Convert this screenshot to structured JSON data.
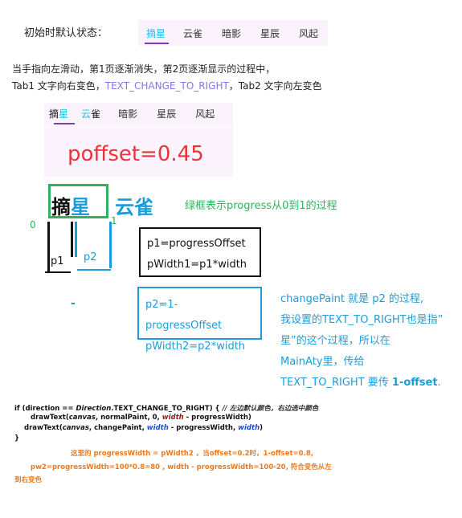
{
  "initial_state_label": "初始时默认状态：",
  "tabs": [
    "摘星",
    "云雀",
    "暗影",
    "星辰",
    "风起"
  ],
  "description": {
    "line1": "当手指向左滑动，第1页逐渐消失，第2页逐渐显示的过程中，",
    "line2_a": "Tab1 文字向右变色，",
    "line2_mode": "TEXT_CHANGE_TO_RIGHT",
    "line2_b": "，Tab2 文字向左变色"
  },
  "demo": {
    "tab1_part1": "摘",
    "tab1_part2": "星",
    "tab2_part1": "云",
    "tab2_part2": "雀",
    "poffset": "poffset=0.45"
  },
  "zoom": {
    "tab1_dark": "摘",
    "tab1_cyan": "星",
    "tab2": "云雀",
    "note": "绿框表示progress从0到1的过程",
    "label0": "0",
    "label1": "1",
    "p1": "p1",
    "p2": "p2",
    "dot": "-"
  },
  "box1": {
    "line1": "p1=progressOffset",
    "line2": "pWidth1=p1*width"
  },
  "box2": {
    "line1": "p2=1-progressOffset",
    "line2": "pWidth2=p2*width"
  },
  "blue_note": {
    "l1": "changePaint 就是 p2 的过程,",
    "l2": "我设置的TEXT_TO_RIGHT也是指”",
    "l3": "星”的这个过程，所以在",
    "l4": "MainAty里，传给",
    "l5a": "TEXT_TO_RIGHT 要传 ",
    "l5b": "1-offset",
    "l5c": "."
  },
  "code": {
    "l1a": "if (direction == ",
    "l1b": "Direction",
    "l1c": ".TEXT_CHANGE_TO_RIGHT) { ",
    "l1d": "// 左边默认颜色，右边选中颜色",
    "l2a": "drawText(",
    "l2b": "canvas",
    "l2c": ", normalPaint, 0, ",
    "l2d": "width",
    "l2e": " - progressWidth)",
    "l3a": "drawText(",
    "l3b": "canvas",
    "l3c": ", changePaint, ",
    "l3d": "width",
    "l3e": " - progressWidth, ",
    "l3f": "width",
    "l3g": ")",
    "l4": "}"
  },
  "orange_note": {
    "l1": "这里的   progressWidth = pWidth2 ，当offset=0.2时，1-offset=0.8,",
    "l2": "pw2=progressWidth=100*0.8=80   , width - progressWidth=100-20, 符合变色从左",
    "l3": "到右变色"
  },
  "colors": {
    "accent_cyan": "#22bfe0",
    "green": "#2fb35f",
    "blue": "#1a9edb",
    "red": "#e8343a",
    "orange": "#ef7a1d",
    "purple": "#7a3fb5"
  }
}
